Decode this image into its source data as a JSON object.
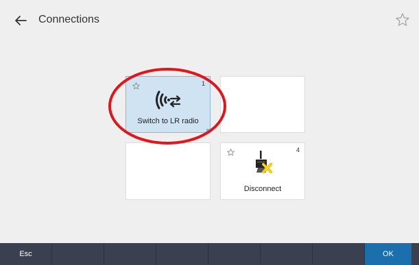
{
  "header": {
    "title": "Connections",
    "back_icon": "arrow-left-icon",
    "favorite_icon": "star-outline-icon"
  },
  "tiles": [
    {
      "label": "Switch to LR radio",
      "number": "1",
      "selected": true,
      "icon": "radio-switch-icon"
    },
    {
      "label": "",
      "number": "",
      "selected": false,
      "icon": ""
    },
    {
      "label": "",
      "number": "",
      "selected": false,
      "icon": ""
    },
    {
      "label": "Disconnect",
      "number": "4",
      "selected": false,
      "icon": "disconnect-icon"
    }
  ],
  "footer": {
    "esc_label": "Esc",
    "ok_label": "OK"
  },
  "colors": {
    "background": "#efefef",
    "tile_selected": "#cfe3f2",
    "footer": "#3a404f",
    "ok_button": "#1b6fad",
    "highlight_circle": "#e0161b"
  }
}
